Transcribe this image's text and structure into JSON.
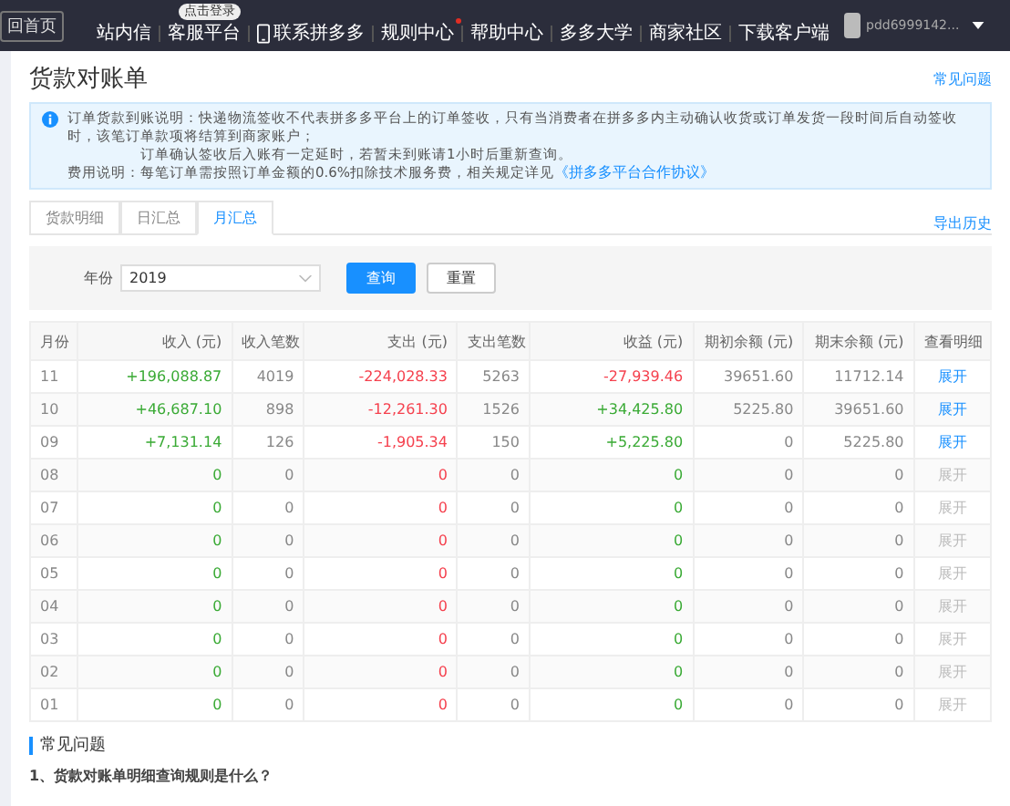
{
  "topbar": {
    "home_button": "回首页",
    "nav": [
      {
        "kind": "text",
        "label": "站内信",
        "dot": false
      },
      {
        "kind": "text",
        "label": "客服平台",
        "badge": "点击登录",
        "dot": false
      },
      {
        "kind": "phone",
        "label": "联系拼多多",
        "dot": false
      },
      {
        "kind": "text",
        "label": "规则中心",
        "dot": true
      },
      {
        "kind": "text",
        "label": "帮助中心",
        "dot": false
      },
      {
        "kind": "text",
        "label": "多多大学",
        "dot": false
      },
      {
        "kind": "text",
        "label": "商家社区",
        "dot": false
      },
      {
        "kind": "text",
        "label": "下载客户端",
        "dot": false
      }
    ],
    "username": "pdd6999142..."
  },
  "page": {
    "title": "货款对账单",
    "help_link": "常见问题"
  },
  "notice": {
    "lines": [
      "订单货款到账说明：快递物流签收不代表拼多多平台上的订单签收，只有当消费者在拼多多内主动确认收货或订单发货一段时间后自动签收时，该笔订单款项将结算到商家账户；",
      "订单确认签收后入账有一定延时，若暂未到账请1小时后重新查询。"
    ],
    "fee_text": "费用说明：每笔订单需按照订单金额的0.6%扣除技术服务费，相关规定详见",
    "fee_link": "《拼多多平台合作协议》"
  },
  "tabs": [
    {
      "label": "货款明细",
      "selected": false
    },
    {
      "label": "日汇总",
      "selected": false
    },
    {
      "label": "月汇总",
      "selected": true
    }
  ],
  "export_link": "导出历史",
  "filter": {
    "label": "年份",
    "value": "2019",
    "search_button": "查询",
    "reset_button": "重置"
  },
  "table": {
    "columns": [
      "月份",
      "收入 (元)",
      "收入笔数",
      "支出 (元)",
      "支出笔数",
      "收益 (元)",
      "期初余额 (元)",
      "期末余额 (元)",
      "查看明细"
    ],
    "rows": [
      {
        "month": "11",
        "income": "+196,088.87",
        "income_count": "4019",
        "expense": "-224,028.33",
        "expense_count": "5263",
        "profit": "-27,939.46",
        "profit_negative": true,
        "opening": "39651.60",
        "closing": "11712.14",
        "action": "展开",
        "enabled": true
      },
      {
        "month": "10",
        "income": "+46,687.10",
        "income_count": "898",
        "expense": "-12,261.30",
        "expense_count": "1526",
        "profit": "+34,425.80",
        "profit_negative": false,
        "opening": "5225.80",
        "closing": "39651.60",
        "action": "展开",
        "enabled": true
      },
      {
        "month": "09",
        "income": "+7,131.14",
        "income_count": "126",
        "expense": "-1,905.34",
        "expense_count": "150",
        "profit": "+5,225.80",
        "profit_negative": false,
        "opening": "0",
        "closing": "5225.80",
        "action": "展开",
        "enabled": true
      },
      {
        "month": "08",
        "income": "0",
        "income_count": "0",
        "expense": "0",
        "expense_count": "0",
        "profit": "0",
        "profit_negative": false,
        "opening": "0",
        "closing": "0",
        "action": "展开",
        "enabled": false
      },
      {
        "month": "07",
        "income": "0",
        "income_count": "0",
        "expense": "0",
        "expense_count": "0",
        "profit": "0",
        "profit_negative": false,
        "opening": "0",
        "closing": "0",
        "action": "展开",
        "enabled": false
      },
      {
        "month": "06",
        "income": "0",
        "income_count": "0",
        "expense": "0",
        "expense_count": "0",
        "profit": "0",
        "profit_negative": false,
        "opening": "0",
        "closing": "0",
        "action": "展开",
        "enabled": false
      },
      {
        "month": "05",
        "income": "0",
        "income_count": "0",
        "expense": "0",
        "expense_count": "0",
        "profit": "0",
        "profit_negative": false,
        "opening": "0",
        "closing": "0",
        "action": "展开",
        "enabled": false
      },
      {
        "month": "04",
        "income": "0",
        "income_count": "0",
        "expense": "0",
        "expense_count": "0",
        "profit": "0",
        "profit_negative": false,
        "opening": "0",
        "closing": "0",
        "action": "展开",
        "enabled": false
      },
      {
        "month": "03",
        "income": "0",
        "income_count": "0",
        "expense": "0",
        "expense_count": "0",
        "profit": "0",
        "profit_negative": false,
        "opening": "0",
        "closing": "0",
        "action": "展开",
        "enabled": false
      },
      {
        "month": "02",
        "income": "0",
        "income_count": "0",
        "expense": "0",
        "expense_count": "0",
        "profit": "0",
        "profit_negative": false,
        "opening": "0",
        "closing": "0",
        "action": "展开",
        "enabled": false
      },
      {
        "month": "01",
        "income": "0",
        "income_count": "0",
        "expense": "0",
        "expense_count": "0",
        "profit": "0",
        "profit_negative": false,
        "opening": "0",
        "closing": "0",
        "action": "展开",
        "enabled": false
      }
    ]
  },
  "faq": {
    "title": "常见问题",
    "question": "1、货款对账单明细查询规则是什么？"
  }
}
